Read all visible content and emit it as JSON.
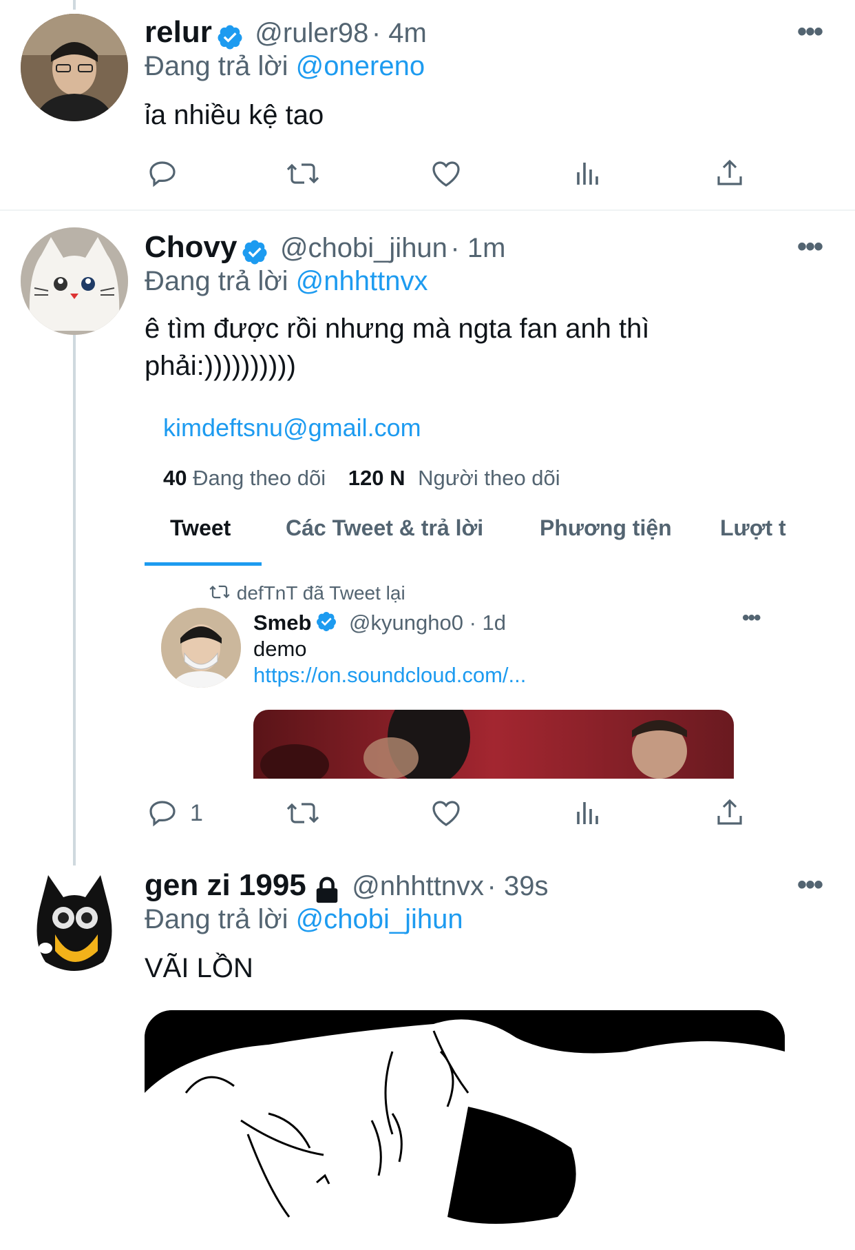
{
  "tweets": [
    {
      "name": "relur",
      "handle": "@ruler98",
      "time": "· 4m",
      "reply_prefix": "Đang trả lời",
      "reply_to": "@onereno",
      "text": "ỉa nhiều kệ tao",
      "verified": true
    },
    {
      "name": "Chovy",
      "handle": "@chobi_jihun",
      "time": "· 1m",
      "reply_prefix": "Đang trả lời",
      "reply_to": "@nhhttnvx",
      "text_line1": "ê tìm được rồi nhưng mà ngta fan anh thì",
      "text_line2": "phải:))))))))))",
      "verified": true,
      "reply_count": "1"
    },
    {
      "name": "gen zi 1995",
      "handle": "@nhhttnvx",
      "time": "· 39s",
      "reply_prefix": "Đang trả lời",
      "reply_to": "@chobi_jihun",
      "text": "VÃI LỒN",
      "locked": true
    }
  ],
  "screenshot_card": {
    "email": "kimdeftsnu@gmail.com",
    "following_count": "40",
    "following_label": "Đang theo dõi",
    "followers_count": "120 N",
    "followers_label": "Người theo dõi",
    "tabs": [
      "Tweet",
      "Các Tweet & trả lời",
      "Phương tiện",
      "Lượt t"
    ],
    "retweet_label": "defTnT đã Tweet lại",
    "inner_tweet": {
      "name": "Smeb",
      "handle": "@kyungho0",
      "time": "· 1d",
      "text": "demo",
      "link": "https://on.soundcloud.com/..."
    }
  },
  "icons": [
    "reply-icon",
    "retweet-icon",
    "like-icon",
    "analytics-icon",
    "share-icon",
    "more-icon",
    "verified-icon",
    "lock-icon"
  ],
  "colors": {
    "accent": "#1d9bf0",
    "secondary_text": "#536471",
    "primary_text": "#0f1419"
  }
}
